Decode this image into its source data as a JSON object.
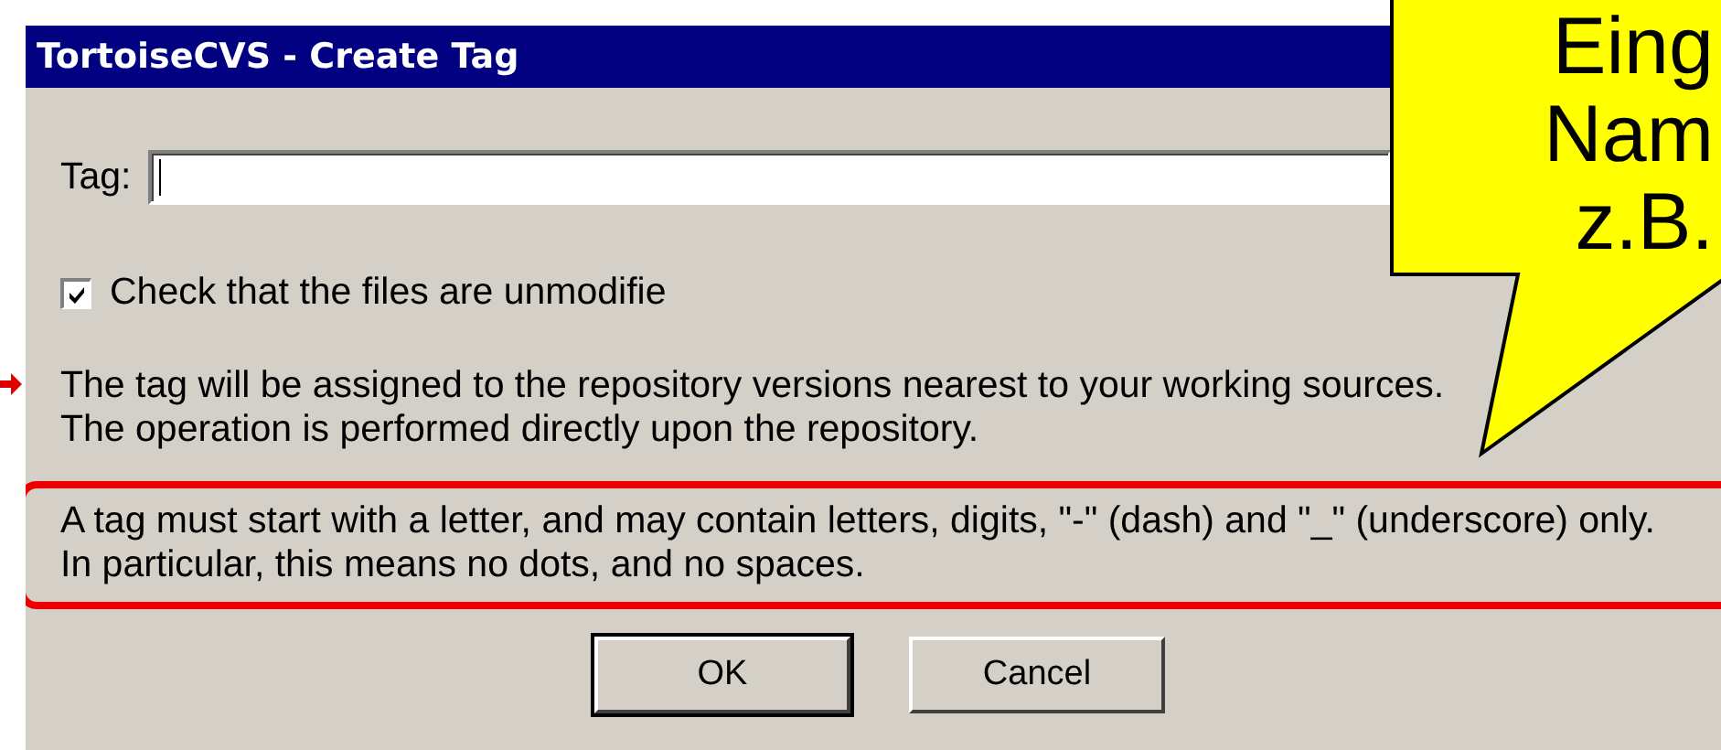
{
  "window": {
    "title": "TortoiseCVS - Create Tag"
  },
  "tag_field": {
    "label": "Tag:",
    "focused": true
  },
  "checkbox": {
    "label": "Check that the files are unmodifie",
    "checked": true
  },
  "info": [
    "The tag will be assigned to the repository versions nearest to your working sources.",
    "The operation is performed directly upon the repository."
  ],
  "rules": [
    "A tag must start with a letter, and may contain letters, digits, \"-\" (dash) and \"_\" (underscore) only.",
    "In particular, this means no dots, and no spaces."
  ],
  "buttons": [
    {
      "label": "OK",
      "default": true
    },
    {
      "label": "Cancel",
      "default": false
    }
  ],
  "callout": {
    "lines": [
      "Eing",
      "Nam",
      "z.B."
    ]
  }
}
